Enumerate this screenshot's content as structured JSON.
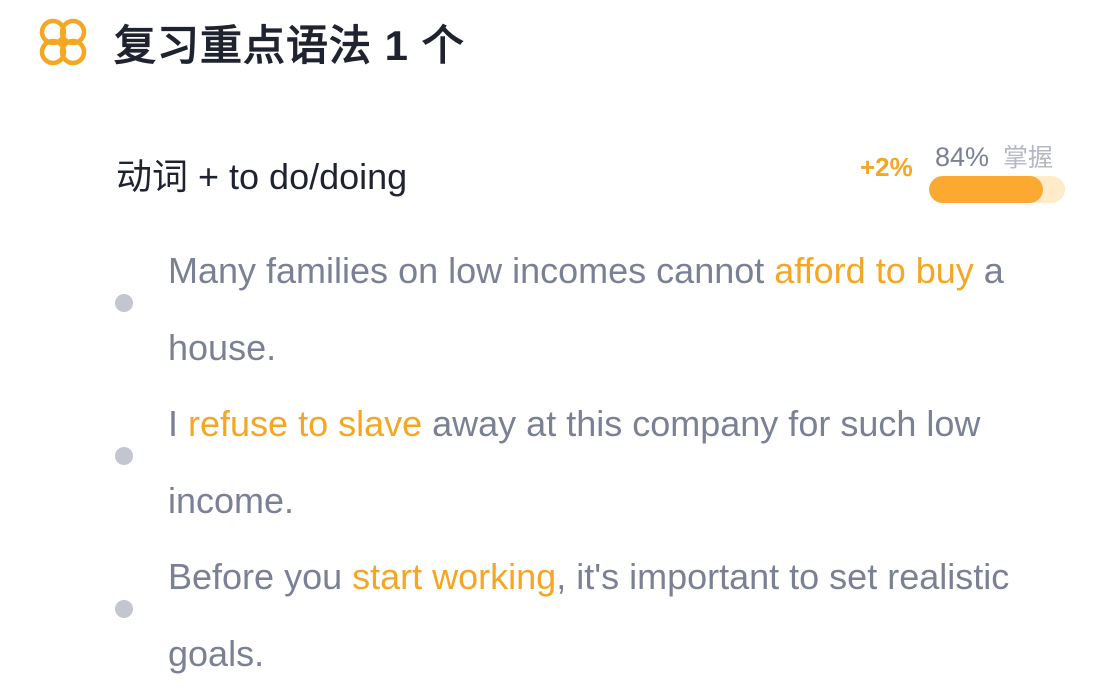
{
  "header": {
    "icon": "knot-icon",
    "title": "复习重点语法 1 个"
  },
  "grammar": {
    "name": "动词 + to do/doing",
    "delta": "+2%",
    "mastery_pct": "84%",
    "mastery_label": "掌握",
    "mastery_value": 0.84
  },
  "examples": [
    {
      "before": "Many families on low incomes cannot ",
      "highlight": "afford to buy",
      "after": " a house."
    },
    {
      "before": "I ",
      "highlight": "refuse to slave",
      "after": " away at this company for such low income."
    },
    {
      "before": "Before you ",
      "highlight": "start working",
      "after": ", it's important to set realistic goals."
    }
  ],
  "colors": {
    "accent": "#f5a623",
    "progress_fill": "#fba931",
    "progress_track": "#fdebc9",
    "title_text": "#1f2330",
    "body_text": "#7b8194",
    "bullet": "#c2c6cf"
  }
}
